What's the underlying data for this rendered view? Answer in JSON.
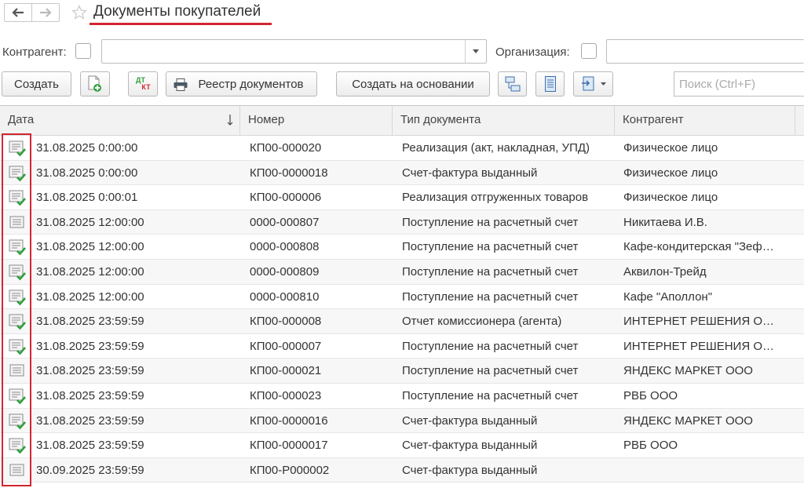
{
  "window": {
    "title": "Документы покупателей"
  },
  "colors": {
    "accent": "#d22630",
    "posted_check": "#2e9e3e"
  },
  "filters": {
    "counterparty_label": "Контрагент:",
    "counterparty_value": "",
    "organization_label": "Организация:",
    "organization_value": ""
  },
  "toolbar": {
    "create_label": "Создать",
    "registry_label": "Реестр документов",
    "create_based_on_label": "Создать на основании",
    "dtkt_top": "ДТ",
    "dtkt_bottom": "КТ"
  },
  "search": {
    "placeholder": "Поиск (Ctrl+F)"
  },
  "table": {
    "columns": [
      {
        "label": "Дата"
      },
      {
        "label": "Номер"
      },
      {
        "label": "Тип документа"
      },
      {
        "label": "Контрагент"
      }
    ],
    "sort_column": "Дата",
    "sort_direction": "descending",
    "rows": [
      {
        "posted": true,
        "date": "31.08.2025 0:00:00",
        "number": "КП00-000020",
        "type": "Реализация (акт, накладная, УПД)",
        "counterparty": "Физическое лицо"
      },
      {
        "posted": true,
        "date": "31.08.2025 0:00:00",
        "number": "КП00-0000018",
        "type": "Счет-фактура выданный",
        "counterparty": "Физическое лицо"
      },
      {
        "posted": true,
        "date": "31.08.2025 0:00:01",
        "number": "КП00-000006",
        "type": "Реализация отгруженных товаров",
        "counterparty": "Физическое лицо"
      },
      {
        "posted": false,
        "date": "31.08.2025 12:00:00",
        "number": "0000-000807",
        "type": "Поступление на расчетный счет",
        "counterparty": "Никитаева И.В."
      },
      {
        "posted": true,
        "date": "31.08.2025 12:00:00",
        "number": "0000-000808",
        "type": "Поступление на расчетный счет",
        "counterparty": "Кафе-кондитерская \"Зеф…"
      },
      {
        "posted": true,
        "date": "31.08.2025 12:00:00",
        "number": "0000-000809",
        "type": "Поступление на расчетный счет",
        "counterparty": "Аквилон-Трейд"
      },
      {
        "posted": true,
        "date": "31.08.2025 12:00:00",
        "number": "0000-000810",
        "type": "Поступление на расчетный счет",
        "counterparty": "Кафе \"Аполлон\""
      },
      {
        "posted": true,
        "date": "31.08.2025 23:59:59",
        "number": "КП00-000008",
        "type": "Отчет комиссионера (агента)",
        "counterparty": "ИНТЕРНЕТ РЕШЕНИЯ О…"
      },
      {
        "posted": true,
        "date": "31.08.2025 23:59:59",
        "number": "КП00-000007",
        "type": "Поступление на расчетный счет",
        "counterparty": "ИНТЕРНЕТ РЕШЕНИЯ О…"
      },
      {
        "posted": false,
        "date": "31.08.2025 23:59:59",
        "number": "КП00-000021",
        "type": "Поступление на расчетный счет",
        "counterparty": "ЯНДЕКС МАРКЕТ ООО"
      },
      {
        "posted": true,
        "date": "31.08.2025 23:59:59",
        "number": "КП00-000023",
        "type": "Поступление на расчетный счет",
        "counterparty": "РВБ ООО"
      },
      {
        "posted": true,
        "date": "31.08.2025 23:59:59",
        "number": "КП00-0000016",
        "type": "Счет-фактура выданный",
        "counterparty": "ЯНДЕКС МАРКЕТ ООО"
      },
      {
        "posted": true,
        "date": "31.08.2025 23:59:59",
        "number": "КП00-0000017",
        "type": "Счет-фактура выданный",
        "counterparty": "РВБ ООО"
      },
      {
        "posted": false,
        "date": "30.09.2025 23:59:59",
        "number": "КП00-Р000002",
        "type": "Счет-фактура выданный",
        "counterparty": ""
      }
    ]
  }
}
